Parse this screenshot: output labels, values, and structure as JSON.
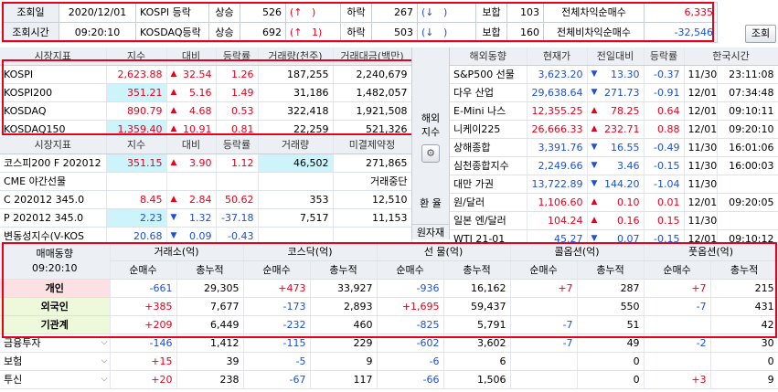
{
  "top": {
    "date_label": "조회일",
    "date_value": "2020/12/01",
    "time_label": "조회시간",
    "time_value": "09:20:10",
    "rows": [
      {
        "market": "KOSPI 등락",
        "up_label": "상승",
        "up_count": "526",
        "up_arrow": "(↑",
        "up_extra": ")",
        "down_label": "하락",
        "down_count": "267",
        "down_arrow": "(↓",
        "down_extra": ")",
        "flat_label": "보합",
        "flat_count": "103",
        "program_label": "전체차익순매수",
        "program_value": "6,335"
      },
      {
        "market": "KOSDAQ등락",
        "up_label": "상승",
        "up_count": "692",
        "up_arrow": "(↑",
        "up_extra": "1)",
        "down_label": "하락",
        "down_count": "503",
        "down_arrow": "(↓",
        "down_extra": ")",
        "flat_label": "보합",
        "flat_count": "160",
        "program_label": "전체비차익순매수",
        "program_value": "-32,546"
      }
    ],
    "query_button": "조회"
  },
  "domestic": {
    "headers": [
      "시장지표",
      "지수",
      "대비",
      "등락률",
      "거래량(천주)",
      "거래대금(백만)"
    ],
    "rows": [
      {
        "name": "KOSPI",
        "index": "2,623.88",
        "dir": "up",
        "change": "32.54",
        "rate": "1.26",
        "volume": "187,255",
        "amount": "2,240,679"
      },
      {
        "name": "KOSPI200",
        "index": "351.21",
        "dir": "up",
        "change": "5.16",
        "rate": "1.49",
        "volume": "31,186",
        "amount": "1,482,057"
      },
      {
        "name": "KOSDAQ",
        "index": "890.79",
        "dir": "up",
        "change": "4.68",
        "rate": "0.53",
        "volume": "322,418",
        "amount": "1,921,508"
      },
      {
        "name": "KOSDAQ150",
        "index": "1,359.40",
        "dir": "up",
        "change": "10.91",
        "rate": "0.81",
        "volume": "22,259",
        "amount": "521,326"
      }
    ]
  },
  "futures": {
    "headers": [
      "시장지표",
      "지수",
      "대비",
      "등락률",
      "거래량",
      "미결제약정"
    ],
    "rows": [
      {
        "name": "코스피200 F 202012",
        "index": "351.15",
        "dir": "up",
        "change": "3.90",
        "rate": "1.12",
        "volume": "46,502",
        "oi": "271,865",
        "color": "red"
      },
      {
        "name": "CME 야간선물",
        "index": "",
        "dir": "",
        "change": "",
        "rate": "",
        "volume": "",
        "oi": "거래중단",
        "color": ""
      },
      {
        "name": "C 202012 345.0",
        "index": "8.45",
        "dir": "up",
        "change": "2.84",
        "rate": "50.62",
        "volume": "353",
        "oi": "12,510",
        "color": "red"
      },
      {
        "name": "P 202012 345.0",
        "index": "2.23",
        "dir": "dn",
        "change": "1.32",
        "rate": "-37.18",
        "volume": "7,517",
        "oi": "11,153",
        "color": "blue"
      },
      {
        "name": "변동성지수(V-KOS",
        "index": "20.68",
        "dir": "dn",
        "change": "0.09",
        "rate": "-0.43",
        "volume": "",
        "oi": "",
        "color": "blue"
      }
    ]
  },
  "side_labels": {
    "overseas": "해외\n지수",
    "exchange": "환 율",
    "commodity": "원자재"
  },
  "overseas": {
    "headers": [
      "해외동향",
      "현재가",
      "전일대비",
      "등락률",
      "한국시간"
    ],
    "rows": [
      {
        "name": "S&P500 선물",
        "price": "3,623.20",
        "dir": "dn",
        "change": "13.30",
        "rate": "-0.37",
        "date": "11/30",
        "time": "23:11:08",
        "color": "blue"
      },
      {
        "name": "다우 산업",
        "price": "29,638.64",
        "dir": "dn",
        "change": "271.73",
        "rate": "-0.91",
        "date": "12/01",
        "time": "07:34:48",
        "color": "blue"
      },
      {
        "name": "E-Mini 나스",
        "price": "12,355.25",
        "dir": "up",
        "change": "78.25",
        "rate": "0.64",
        "date": "12/01",
        "time": "09:10:11",
        "color": "red"
      },
      {
        "name": "니케이225",
        "price": "26,666.33",
        "dir": "up",
        "change": "232.71",
        "rate": "0.88",
        "date": "12/01",
        "time": "09:20:10",
        "color": "red"
      },
      {
        "name": "상해종합",
        "price": "3,391.76",
        "dir": "dn",
        "change": "16.55",
        "rate": "-0.49",
        "date": "11/30",
        "time": "16:01:06",
        "color": "blue"
      },
      {
        "name": "심천종합지수",
        "price": "2,249.66",
        "dir": "dn",
        "change": "3.46",
        "rate": "-0.15",
        "date": "11/30",
        "time": "16:00:03",
        "color": "blue"
      },
      {
        "name": "대만 가권",
        "price": "13,722.89",
        "dir": "dn",
        "change": "144.20",
        "rate": "-1.04",
        "date": "11/30",
        "time": "",
        "color": "blue"
      },
      {
        "name": "원/달러",
        "price": "1,106.60",
        "dir": "up",
        "change": "0.10",
        "rate": "0.01",
        "date": "12/01",
        "time": "09:20:05",
        "color": "red"
      },
      {
        "name": "일본 엔/달러",
        "price": "104.24",
        "dir": "up",
        "change": "0.16",
        "rate": "0.15",
        "date": "11/30",
        "time": "",
        "color": "red"
      },
      {
        "name": "WTI 21-01",
        "price": "45.27",
        "dir": "dn",
        "change": "0.07",
        "rate": "-0.15",
        "date": "12/01",
        "time": "09:10:12",
        "color": "blue"
      }
    ]
  },
  "investor": {
    "title": "매매동향",
    "time": "09:20:10",
    "groups": [
      "거래소(억)",
      "코스닥(억)",
      "선 물(억)",
      "콜옵션(억)",
      "풋옵션(억)"
    ],
    "sub_headers": [
      "순매수",
      "총누적"
    ],
    "rows": [
      {
        "name": "개인",
        "style": "pink",
        "values": [
          "-661",
          "29,305",
          "+473",
          "33,927",
          "-936",
          "16,162",
          "+7",
          "287",
          "+7",
          "215"
        ]
      },
      {
        "name": "외국인",
        "style": "lgreen",
        "values": [
          "+385",
          "7,677",
          "-173",
          "2,893",
          "+1,695",
          "59,437",
          "",
          "550",
          "-7",
          "431"
        ]
      },
      {
        "name": "기관계",
        "style": "lgreen",
        "values": [
          "+209",
          "6,449",
          "-232",
          "460",
          "-825",
          "5,791",
          "-7",
          "51",
          "",
          "42"
        ]
      },
      {
        "name": "금융투자",
        "style": "sel",
        "values": [
          "-146",
          "1,412",
          "-115",
          "229",
          "-602",
          "3,602",
          "-7",
          "49",
          "-2",
          "30"
        ]
      },
      {
        "name": "보험",
        "style": "sel",
        "values": [
          "+15",
          "39",
          "-5",
          "9",
          "-6",
          "6",
          "",
          "0",
          "",
          "0"
        ]
      },
      {
        "name": "투신",
        "style": "sel",
        "values": [
          "+20",
          "238",
          "-67",
          "117",
          "-66",
          "1,506",
          "",
          "0",
          "+3",
          "9"
        ]
      }
    ]
  },
  "colors": {
    "up": "#e8001c",
    "down": "#1e4fd8",
    "highlight": "#e8001c",
    "cyan": "#cdf3fb"
  }
}
